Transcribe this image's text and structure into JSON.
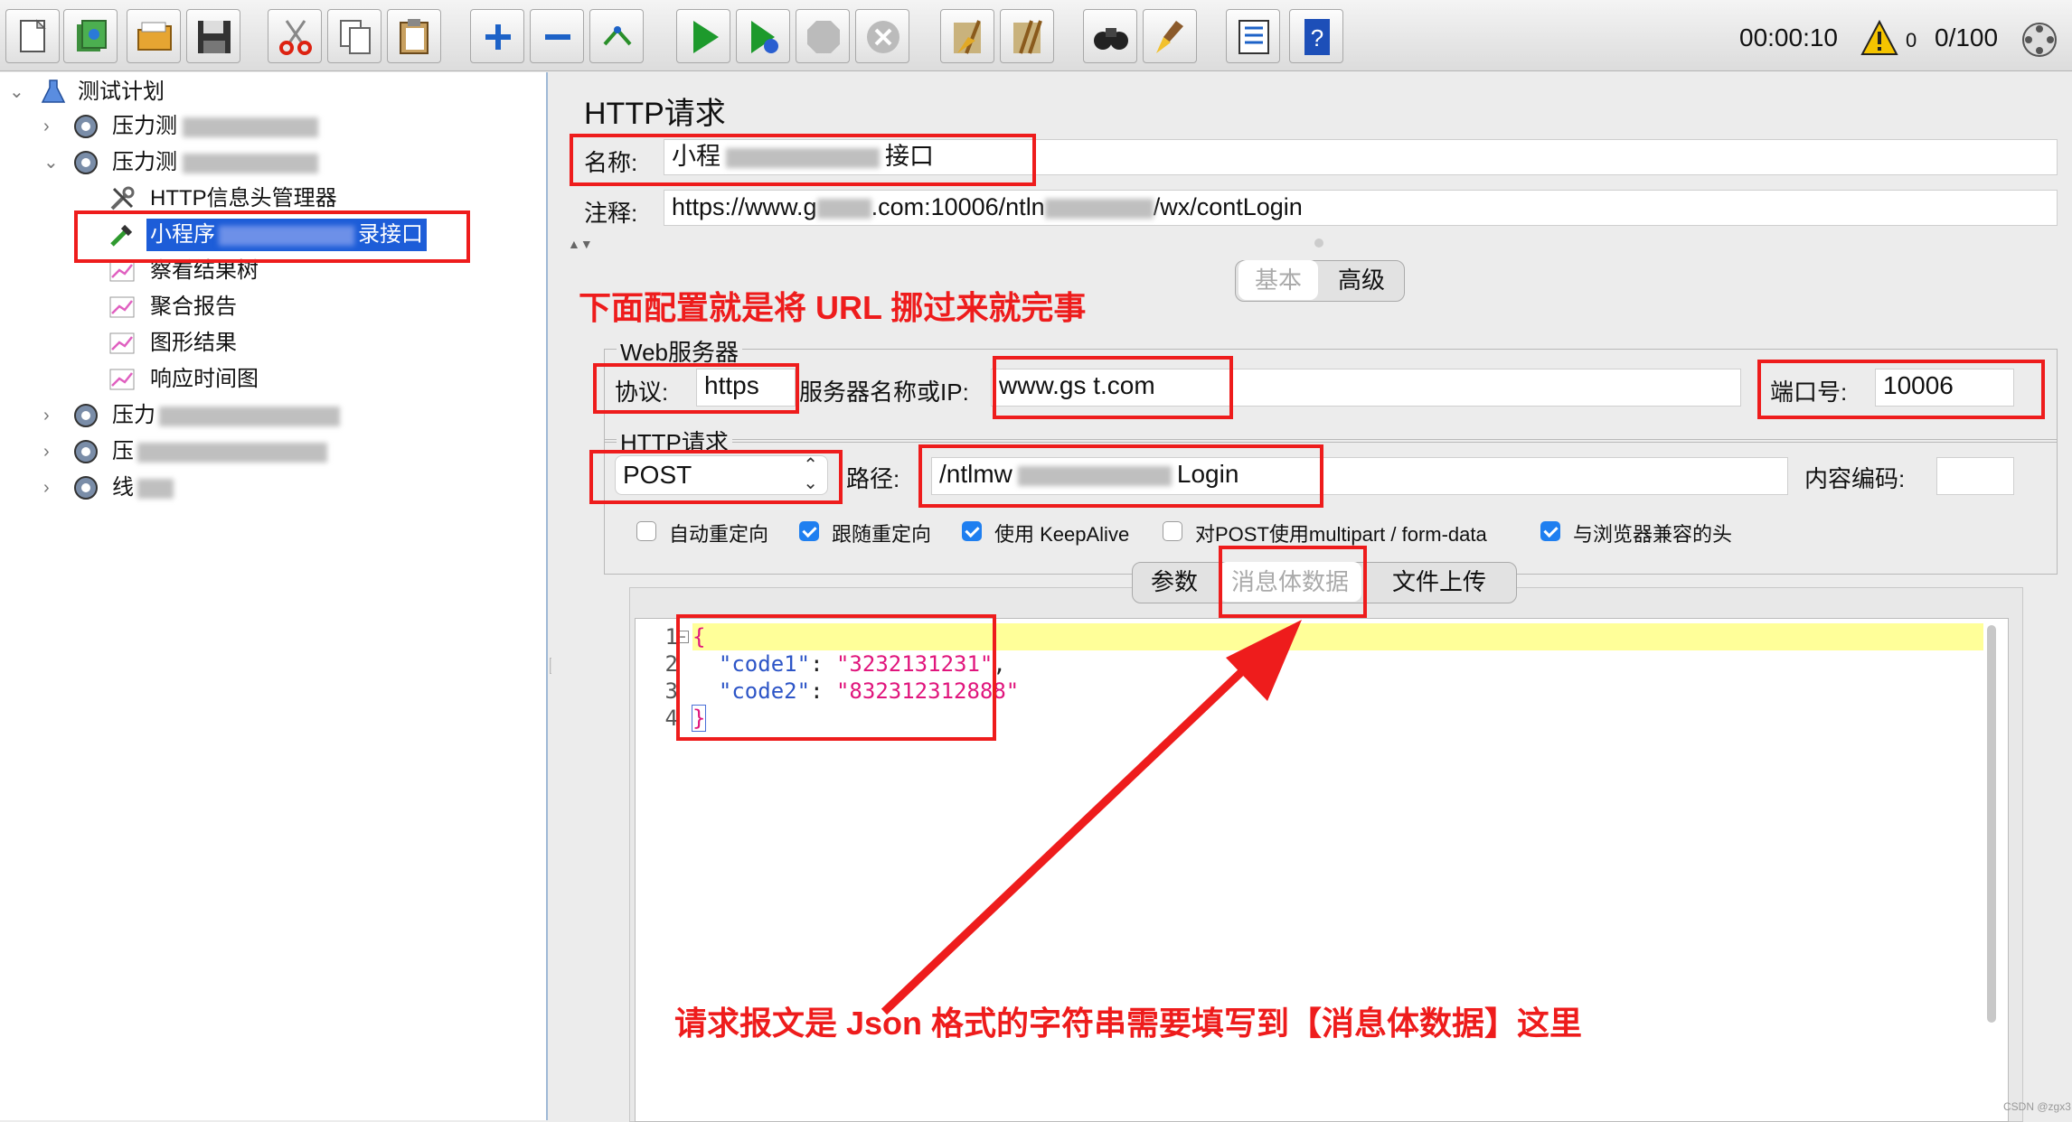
{
  "toolbar": {
    "elapsed_time": "00:00:10",
    "warning_count": "0",
    "thread_counter": "0/100",
    "buttons": [
      "new-icon",
      "templates-icon",
      "open-icon",
      "save-icon",
      "cut-icon",
      "copy-icon",
      "paste-icon",
      "expand-icon",
      "collapse-icon",
      "toggle-icon",
      "start-icon",
      "start-no-pause-icon",
      "stop-icon",
      "shutdown-icon",
      "clear-icon",
      "clear-all-icon",
      "search-icon",
      "reset-search-icon",
      "function-helper-icon",
      "help-icon"
    ]
  },
  "tree": {
    "root": "测试计划",
    "items": [
      {
        "label": "压力测",
        "blurred": true
      },
      {
        "label": "压力测",
        "blurred": true
      },
      {
        "label": "HTTP信息头管理器"
      },
      {
        "label_prefix": "小程序",
        "label_suffix": "录接口",
        "selected": true
      },
      {
        "label": "察看结果树"
      },
      {
        "label": "聚合报告"
      },
      {
        "label": "图形结果"
      },
      {
        "label": "响应时间图"
      },
      {
        "label": "压力",
        "blurred": true
      },
      {
        "label": "压",
        "blurred": true
      },
      {
        "label": "线",
        "blurred": true
      }
    ]
  },
  "panel": {
    "title": "HTTP请求",
    "name_label": "名称:",
    "name_value_prefix": "小程",
    "name_value_suffix": "接口",
    "comment_label": "注释:",
    "comment_value_prefix": "https://www.g",
    "comment_value_mid": ".com:10006/ntln",
    "comment_value_suffix": "/wx/contLogin",
    "tabs": {
      "basic": "基本",
      "advanced": "高级"
    },
    "web_server": {
      "legend": "Web服务器",
      "protocol_label": "协议:",
      "protocol_value": "https",
      "server_label": "服务器名称或IP:",
      "server_value": "www.gs   t.com",
      "port_label": "端口号:",
      "port_value": "10006"
    },
    "http_request": {
      "legend": "HTTP请求",
      "method": "POST",
      "path_label": "路径:",
      "path_prefix": "/ntlmw",
      "path_suffix": "Login",
      "encoding_label": "内容编码:",
      "encoding_value": ""
    },
    "options": [
      {
        "label": "自动重定向",
        "checked": false
      },
      {
        "label": "跟随重定向",
        "checked": true
      },
      {
        "label": "使用 KeepAlive",
        "checked": true
      },
      {
        "label": "对POST使用multipart / form-data",
        "checked": false
      },
      {
        "label": "与浏览器兼容的头",
        "checked": true
      }
    ],
    "body_tabs": {
      "params": "参数",
      "body": "消息体数据",
      "files": "文件上传"
    },
    "code_lines": [
      "{",
      "  \"code1\": \"3232131231\",",
      "  \"code2\": \"832312312888\"",
      "}"
    ],
    "line_numbers": [
      "1",
      "2",
      "3",
      "4"
    ],
    "code_strings": {
      "brace_open": "{",
      "key1": "\"code1\"",
      "colon": ": ",
      "val1": "\"3232131231\"",
      "comma": ",",
      "key2": "\"code2\"",
      "val2": "\"832312312888\"",
      "brace_close": "}"
    }
  },
  "annotations": {
    "top": "下面配置就是将 URL 挪过来就完事",
    "bottom": "请求报文是 Json 格式的字符串需要填写到【消息体数据】这里",
    "watermark": "CSDN @zgx3"
  },
  "colors": {
    "accent_red": "#ee1c1c",
    "selection": "#1d5dd8",
    "checkbox": "#1f7ff0",
    "json_string": "#e0157c",
    "highlight_line": "#ffff99"
  }
}
